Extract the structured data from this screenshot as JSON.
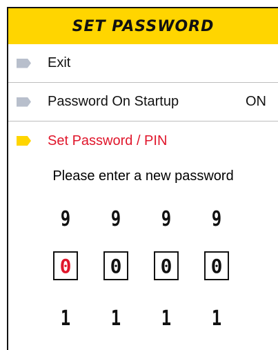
{
  "colors": {
    "header_bg": "#ffd500",
    "inactive_marker": "#b8bfcc",
    "active_marker": "#ffd500",
    "active_text": "#e0162b",
    "text": "#111111"
  },
  "header": {
    "title": "SET PASSWORD"
  },
  "menu": {
    "items": [
      {
        "label": "Exit",
        "value": "",
        "icon": "arrow-marker-icon",
        "active": false
      },
      {
        "label": "Password On Startup",
        "value": "ON",
        "icon": "arrow-marker-icon",
        "active": false
      },
      {
        "label": "Set Password / PIN",
        "value": "",
        "icon": "arrow-marker-icon",
        "active": true
      }
    ]
  },
  "password_entry": {
    "prompt": "Please enter a new password",
    "up_digits": [
      "9",
      "9",
      "9",
      "9"
    ],
    "current_digits": [
      "0",
      "0",
      "0",
      "0"
    ],
    "down_digits": [
      "1",
      "1",
      "1",
      "1"
    ],
    "selected_position": 1
  }
}
